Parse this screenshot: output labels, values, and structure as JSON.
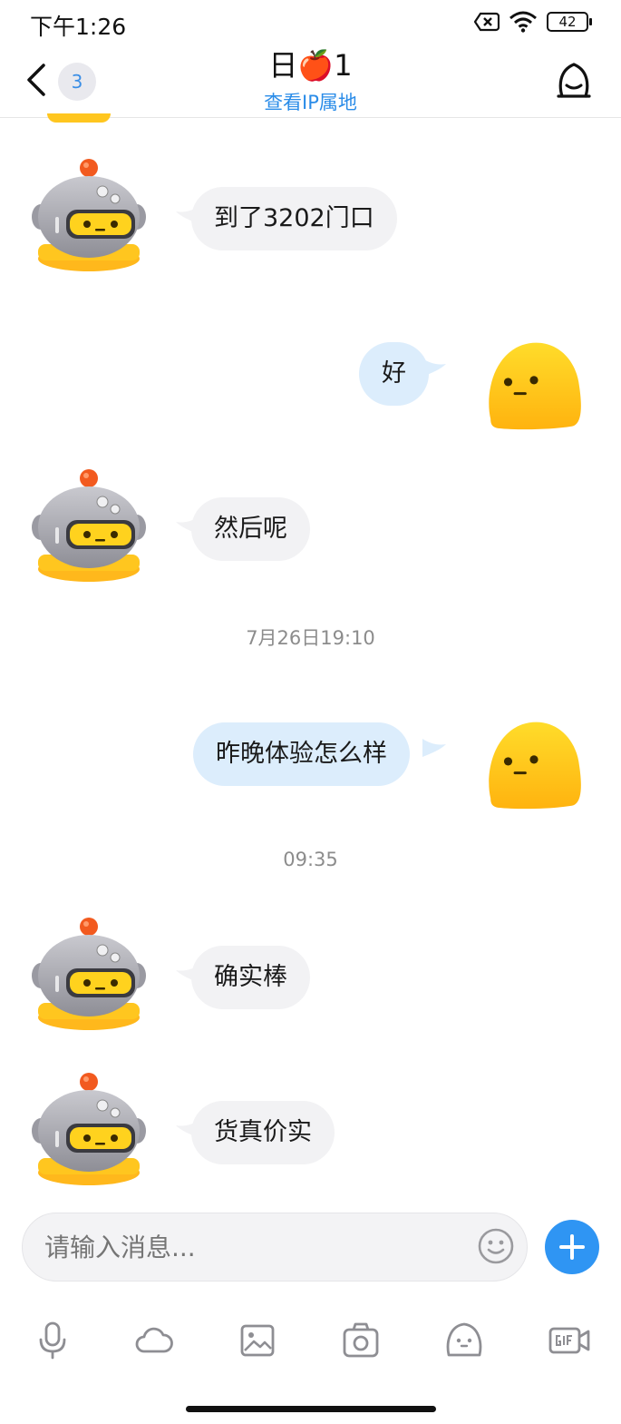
{
  "status_bar": {
    "time": "下午1:26",
    "battery": "42"
  },
  "header": {
    "unread_count": "3",
    "title": "日🍎1",
    "ip_link": "查看IP属地"
  },
  "messages": [
    {
      "side": "left",
      "text": "到了3202门口"
    },
    {
      "side": "right",
      "text": "好"
    },
    {
      "side": "left",
      "text": "然后呢"
    },
    {
      "type": "timestamp",
      "text": "7月26日19:10"
    },
    {
      "side": "right",
      "text": "昨晚体验怎么样"
    },
    {
      "type": "timestamp",
      "text": "09:35"
    },
    {
      "side": "left",
      "text": "确实棒"
    },
    {
      "side": "left",
      "text": "货真价实"
    }
  ],
  "input": {
    "placeholder": "请输入消息..."
  },
  "toolbar": {
    "icons": [
      "microphone-icon",
      "cloud-icon",
      "image-icon",
      "camera-icon",
      "sticker-icon",
      "gif-icon"
    ]
  },
  "colors": {
    "accent": "#2f95f3",
    "link": "#2a8ce8",
    "left_bubble": "#f2f2f4",
    "right_bubble": "#dcedfc",
    "robot_visor": "#ffd21e",
    "blob": "#ffc617"
  }
}
